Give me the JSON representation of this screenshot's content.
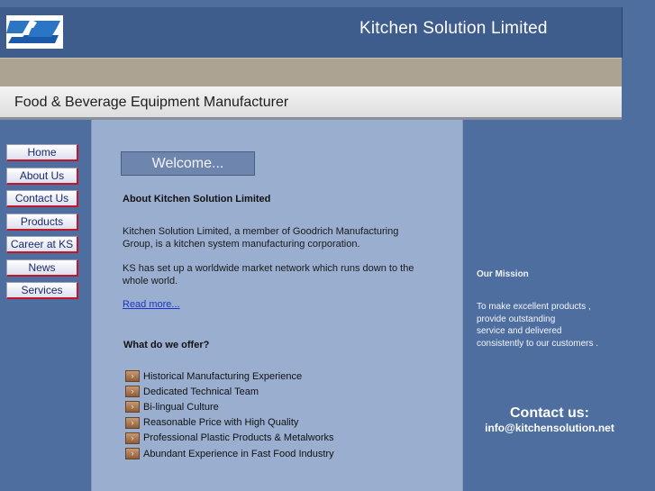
{
  "header": {
    "title": "Kitchen Solution Limited",
    "logo_icon": "ks-logo-icon",
    "subtitle": "Food & Beverage Equipment Manufacturer"
  },
  "colors": {
    "background": "#4e6ea0",
    "header": "#3f5d8c",
    "tan_band": "#aca392",
    "content_panel": "#9aaed0",
    "nav_accent": "#c0182a",
    "link": "#1a35c8"
  },
  "nav": {
    "items": [
      {
        "label": "Home"
      },
      {
        "label": "About Us"
      },
      {
        "label": "Contact Us"
      },
      {
        "label": "Products"
      },
      {
        "label": "Career at KS"
      },
      {
        "label": "News"
      },
      {
        "label": "Services"
      }
    ]
  },
  "main": {
    "welcome": "Welcome...",
    "about_heading": "About Kitchen Solution Limited",
    "para1": "Kitchen Solution Limited, a member of Goodrich Manufacturing Group, is a kitchen system manufacturing corporation.",
    "para2": "KS has set up a worldwide market network which runs down to the whole world.",
    "read_more": "Read more...",
    "offer_heading": "What do we offer?",
    "bullet_icon": "arrow-bullet-icon",
    "bullet_glyph": "›",
    "offers": [
      "Historical Manufacturing Experience",
      "Dedicated Technical Team",
      "Bi-lingual Culture",
      "Reasonable Price with High Quality",
      "Professional Plastic Products & Metalworks",
      "Abundant Experience in Fast Food Industry"
    ]
  },
  "side": {
    "mission_heading": "Our Mission",
    "mission_lines": [
      "To make excellent products ,",
      "provide outstanding",
      "service and delivered",
      "consistently to our customers ."
    ],
    "contact_heading": "Contact us:",
    "contact_email": "info@kitchensolution.net"
  }
}
